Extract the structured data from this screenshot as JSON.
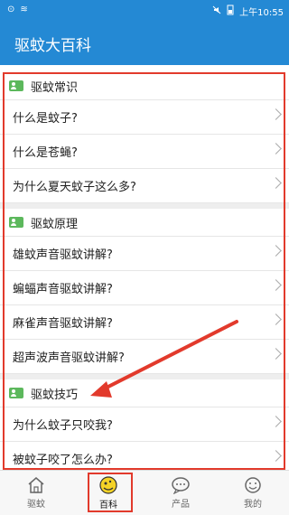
{
  "statusbar": {
    "signal": "⊙",
    "wifi": "≋",
    "time": "上午10:55"
  },
  "app": {
    "title": "驱蚊大百科"
  },
  "sections": [
    {
      "title": "驱蚊常识",
      "items": [
        "什么是蚊子?",
        "什么是苍蝇?",
        "为什么夏天蚊子这么多?"
      ]
    },
    {
      "title": "驱蚊原理",
      "items": [
        "雄蚊声音驱蚊讲解?",
        "蝙蝠声音驱蚊讲解?",
        "麻雀声音驱蚊讲解?",
        "超声波声音驱蚊讲解?"
      ]
    },
    {
      "title": "驱蚊技巧",
      "items": [
        "为什么蚊子只咬我?",
        "被蚊子咬了怎么办?"
      ]
    }
  ],
  "tabs": [
    {
      "label": "驱蚊",
      "icon": "home-icon"
    },
    {
      "label": "百科",
      "icon": "encyclopedia-icon"
    },
    {
      "label": "产品",
      "icon": "chat-icon"
    },
    {
      "label": "我的",
      "icon": "smiley-icon"
    }
  ],
  "colors": {
    "primary": "#2489d4",
    "annotation": "#e23a2c"
  }
}
